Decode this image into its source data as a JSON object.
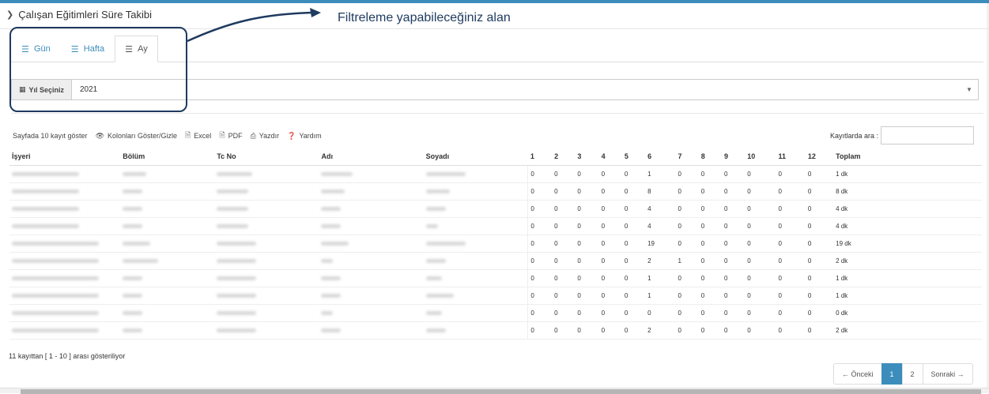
{
  "header": {
    "title": "Çalışan Eğitimleri Süre Takibi"
  },
  "annotation": {
    "text": "Filtreleme yapabileceğiniz alan"
  },
  "tabs": [
    {
      "label": "Gün",
      "active": false
    },
    {
      "label": "Hafta",
      "active": false
    },
    {
      "label": "Ay",
      "active": true
    }
  ],
  "year_filter": {
    "label": "Yıl Seçiniz",
    "value": "2021"
  },
  "toolbar": {
    "page_size": "Sayfada 10 kayıt göster",
    "columns": "Kolonları Göster/Gizle",
    "excel": "Excel",
    "pdf": "PDF",
    "print": "Yazdır",
    "help": "Yardım"
  },
  "search": {
    "label": "Kayıtlarda ara :",
    "value": ""
  },
  "table": {
    "columns": [
      "İşyeri",
      "Bölüm",
      "Tc No",
      "Adı",
      "Soyadı",
      "1",
      "2",
      "3",
      "4",
      "5",
      "6",
      "7",
      "8",
      "9",
      "10",
      "11",
      "12",
      "Toplam"
    ],
    "rows": [
      [
        "0",
        "0",
        "0",
        "0",
        "0",
        "1",
        "0",
        "0",
        "0",
        "0",
        "0",
        "0",
        "1 dk"
      ],
      [
        "0",
        "0",
        "0",
        "0",
        "0",
        "8",
        "0",
        "0",
        "0",
        "0",
        "0",
        "0",
        "8 dk"
      ],
      [
        "0",
        "0",
        "0",
        "0",
        "0",
        "4",
        "0",
        "0",
        "0",
        "0",
        "0",
        "0",
        "4 dk"
      ],
      [
        "0",
        "0",
        "0",
        "0",
        "0",
        "4",
        "0",
        "0",
        "0",
        "0",
        "0",
        "0",
        "4 dk"
      ],
      [
        "0",
        "0",
        "0",
        "0",
        "0",
        "19",
        "0",
        "0",
        "0",
        "0",
        "0",
        "0",
        "19 dk"
      ],
      [
        "0",
        "0",
        "0",
        "0",
        "0",
        "2",
        "1",
        "0",
        "0",
        "0",
        "0",
        "0",
        "2 dk"
      ],
      [
        "0",
        "0",
        "0",
        "0",
        "0",
        "1",
        "0",
        "0",
        "0",
        "0",
        "0",
        "0",
        "1 dk"
      ],
      [
        "0",
        "0",
        "0",
        "0",
        "0",
        "1",
        "0",
        "0",
        "0",
        "0",
        "0",
        "0",
        "1 dk"
      ],
      [
        "0",
        "0",
        "0",
        "0",
        "0",
        "0",
        "0",
        "0",
        "0",
        "0",
        "0",
        "0",
        "0 dk"
      ],
      [
        "0",
        "0",
        "0",
        "0",
        "0",
        "2",
        "0",
        "0",
        "0",
        "0",
        "0",
        "0",
        "2 dk"
      ]
    ]
  },
  "info": "11 kayıttan [ 1 - 10 ] arası gösteriliyor",
  "pagination": {
    "prev": "← Önceki",
    "pages": [
      "1",
      "2"
    ],
    "current": "1",
    "next": "Sonraki →"
  },
  "colors": {
    "accent": "#3c8dbc",
    "callout": "#1e3a5f"
  }
}
